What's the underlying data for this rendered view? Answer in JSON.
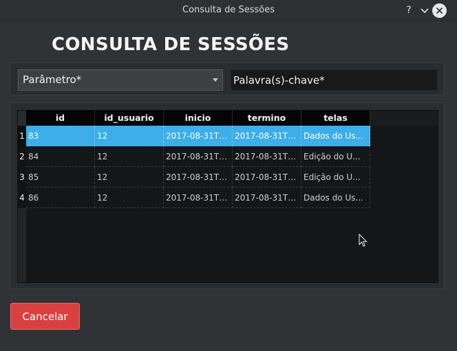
{
  "window": {
    "title": "Consulta de Sessões",
    "help_glyph": "?",
    "minimize_glyph": "⌄",
    "close_glyph": "✕"
  },
  "page": {
    "heading": "CONSULTA DE SESSÕES"
  },
  "filters": {
    "parameter_select": {
      "value": "Parâmetro*"
    },
    "keyword_input": {
      "placeholder": "Palavra(s)-chave*",
      "value": ""
    }
  },
  "table": {
    "columns": [
      "id",
      "id_usuario",
      "inicio",
      "termino",
      "telas"
    ],
    "rows": [
      {
        "num": "1",
        "selected": true,
        "cells": [
          "83",
          "12",
          "2017-08-31T1...",
          "2017-08-31T1...",
          "Dados do Us..."
        ]
      },
      {
        "num": "2",
        "selected": false,
        "cells": [
          "84",
          "12",
          "2017-08-31T1...",
          "2017-08-31T1...",
          "Edição do U..."
        ]
      },
      {
        "num": "3",
        "selected": false,
        "cells": [
          "85",
          "12",
          "2017-08-31T1...",
          "2017-08-31T1...",
          "Edição do U..."
        ]
      },
      {
        "num": "4",
        "selected": false,
        "cells": [
          "86",
          "12",
          "2017-08-31T1...",
          "2017-08-31T1...",
          "Dados do Us..."
        ]
      }
    ],
    "selection_color": "#3daee9"
  },
  "actions": {
    "cancel_label": "Cancelar",
    "cancel_color": "#da4040"
  }
}
